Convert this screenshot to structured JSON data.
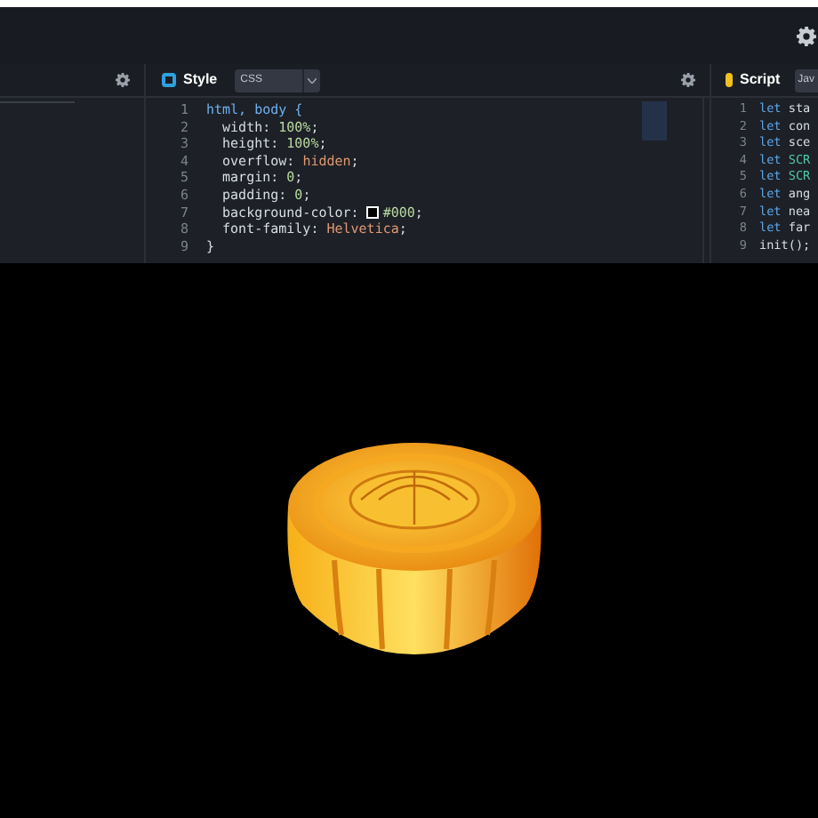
{
  "style_panel": {
    "title": "Style",
    "language": "CSS",
    "lines": [
      {
        "number": "1",
        "tokens": [
          {
            "kind": "selector",
            "text": "html, body {"
          }
        ]
      },
      {
        "number": "2",
        "tokens": [
          {
            "kind": "property",
            "text": "  width: "
          },
          {
            "kind": "number",
            "text": "100%"
          },
          {
            "kind": "plain",
            "text": ";"
          }
        ]
      },
      {
        "number": "3",
        "tokens": [
          {
            "kind": "property",
            "text": "  height: "
          },
          {
            "kind": "number",
            "text": "100%"
          },
          {
            "kind": "plain",
            "text": ";"
          }
        ]
      },
      {
        "number": "4",
        "tokens": [
          {
            "kind": "property",
            "text": "  overflow: "
          },
          {
            "kind": "value",
            "text": "hidden"
          },
          {
            "kind": "plain",
            "text": ";"
          }
        ]
      },
      {
        "number": "5",
        "tokens": [
          {
            "kind": "property",
            "text": "  margin: "
          },
          {
            "kind": "number",
            "text": "0"
          },
          {
            "kind": "plain",
            "text": ";"
          }
        ]
      },
      {
        "number": "6",
        "tokens": [
          {
            "kind": "property",
            "text": "  padding: "
          },
          {
            "kind": "number",
            "text": "0"
          },
          {
            "kind": "plain",
            "text": ";"
          }
        ]
      },
      {
        "number": "7",
        "tokens": [
          {
            "kind": "property",
            "text": "  background-color: "
          },
          {
            "kind": "swatch",
            "color": "#000000"
          },
          {
            "kind": "number",
            "text": "#000"
          },
          {
            "kind": "plain",
            "text": ";"
          }
        ]
      },
      {
        "number": "8",
        "tokens": [
          {
            "kind": "property",
            "text": "  font-family: "
          },
          {
            "kind": "value",
            "text": "Helvetica"
          },
          {
            "kind": "plain",
            "text": ";"
          }
        ]
      },
      {
        "number": "9",
        "tokens": [
          {
            "kind": "plain",
            "text": "}"
          }
        ]
      }
    ]
  },
  "script_panel": {
    "title": "Script",
    "language": "Jav",
    "lines": [
      {
        "number": "1",
        "tokens": [
          {
            "kind": "keyword",
            "text": "let "
          },
          {
            "kind": "plain",
            "text": "sta"
          }
        ]
      },
      {
        "number": "2",
        "tokens": [
          {
            "kind": "keyword",
            "text": "let "
          },
          {
            "kind": "plain",
            "text": "con"
          }
        ]
      },
      {
        "number": "3",
        "tokens": [
          {
            "kind": "keyword",
            "text": "let "
          },
          {
            "kind": "plain",
            "text": "sce"
          }
        ]
      },
      {
        "number": "4",
        "tokens": [
          {
            "kind": "keyword",
            "text": "let "
          },
          {
            "kind": "constant",
            "text": "SCR"
          }
        ]
      },
      {
        "number": "5",
        "tokens": [
          {
            "kind": "keyword",
            "text": "let "
          },
          {
            "kind": "constant",
            "text": "SCR"
          }
        ]
      },
      {
        "number": "6",
        "tokens": [
          {
            "kind": "keyword",
            "text": "let "
          },
          {
            "kind": "plain",
            "text": "ang"
          }
        ]
      },
      {
        "number": "7",
        "tokens": [
          {
            "kind": "keyword",
            "text": "let "
          },
          {
            "kind": "plain",
            "text": "nea"
          }
        ]
      },
      {
        "number": "8",
        "tokens": [
          {
            "kind": "keyword",
            "text": "let "
          },
          {
            "kind": "plain",
            "text": "far"
          }
        ]
      },
      {
        "number": "9",
        "tokens": [
          {
            "kind": "plain",
            "text": "init();"
          }
        ]
      }
    ]
  }
}
